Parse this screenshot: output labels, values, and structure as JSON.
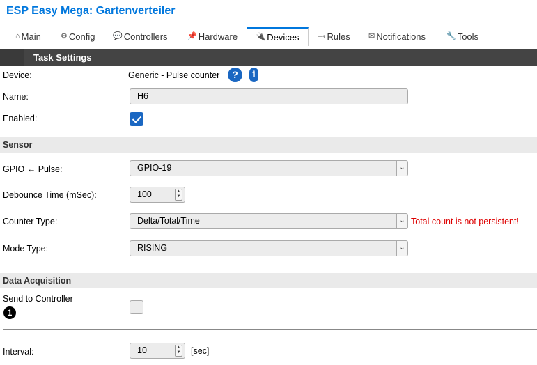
{
  "app": {
    "title": "ESP Easy Mega: Gartenverteiler"
  },
  "tabs": [
    {
      "icon": "⌂",
      "label": "Main"
    },
    {
      "icon": "⚙",
      "label": "Config"
    },
    {
      "icon": "💬",
      "label": "Controllers"
    },
    {
      "icon": "📌",
      "label": "Hardware"
    },
    {
      "icon": "🔌",
      "label": "Devices"
    },
    {
      "icon": "⤏",
      "label": "Rules"
    },
    {
      "icon": "✉",
      "label": "Notifications"
    },
    {
      "icon": "🔧",
      "label": "Tools"
    }
  ],
  "active_tab": "Devices",
  "task_settings": {
    "header": "Task Settings",
    "device_label": "Device:",
    "device_value": "Generic - Pulse counter",
    "help_glyph": "?",
    "info_glyph": "i",
    "name_label": "Name:",
    "name_value": "H6",
    "enabled_label": "Enabled:",
    "enabled": true
  },
  "sensor": {
    "header": "Sensor",
    "gpio_label": "GPIO ← Pulse:",
    "gpio_value": "GPIO-19",
    "debounce_label": "Debounce Time (mSec):",
    "debounce_value": "100",
    "counter_type_label": "Counter Type:",
    "counter_type_value": "Delta/Total/Time",
    "counter_warning": "Total count is not persistent!",
    "mode_type_label": "Mode Type:",
    "mode_type_value": "RISING"
  },
  "data_acquisition": {
    "header": "Data Acquisition",
    "send_label": "Send to Controller",
    "controller_number": "1",
    "send_enabled": false,
    "interval_label": "Interval:",
    "interval_value": "10",
    "interval_unit": "[sec]"
  },
  "colors": {
    "accent": "#0077dd",
    "header_bar": "#444444",
    "warning": "#dd0000",
    "checkbox": "#1a67c2"
  }
}
